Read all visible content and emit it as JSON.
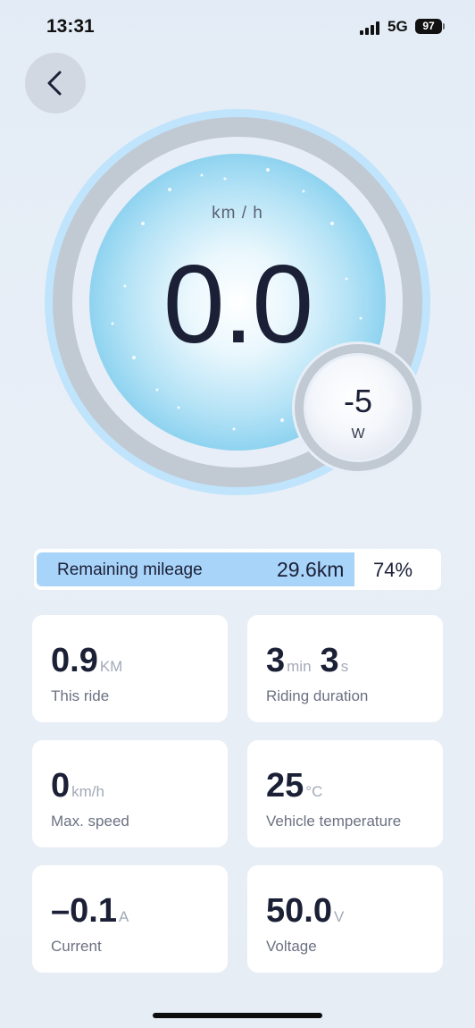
{
  "status_bar": {
    "time": "13:31",
    "network": "5G",
    "battery": "97"
  },
  "header": {
    "back_icon": "chevron-left-icon"
  },
  "speedometer": {
    "unit": "km / h",
    "speed": "0.0",
    "power_value": "-5",
    "power_unit": "W"
  },
  "mileage": {
    "label": "Remaining mileage",
    "distance": "29.6km",
    "percent": "74%",
    "fill_fraction": 0.79
  },
  "stats": [
    {
      "label": "This ride",
      "parts": [
        {
          "value": "0.9",
          "unit": "KM"
        }
      ]
    },
    {
      "label": "Riding duration",
      "parts": [
        {
          "value": "3",
          "unit": "min"
        },
        {
          "value": "3",
          "unit": "s"
        }
      ]
    },
    {
      "label": "Max. speed",
      "parts": [
        {
          "value": "0",
          "unit": "km/h"
        }
      ]
    },
    {
      "label": "Vehicle temperature",
      "parts": [
        {
          "value": "25",
          "unit": "°C"
        }
      ]
    },
    {
      "label": "Current",
      "parts": [
        {
          "value": "–0.1",
          "unit": "A"
        }
      ]
    },
    {
      "label": "Voltage",
      "parts": [
        {
          "value": "50.0",
          "unit": "V"
        }
      ]
    }
  ],
  "colors": {
    "accent_light_blue": "#a9d4fa",
    "ring_blue": "#bfe4fb",
    "text_dark": "#1b2036"
  }
}
